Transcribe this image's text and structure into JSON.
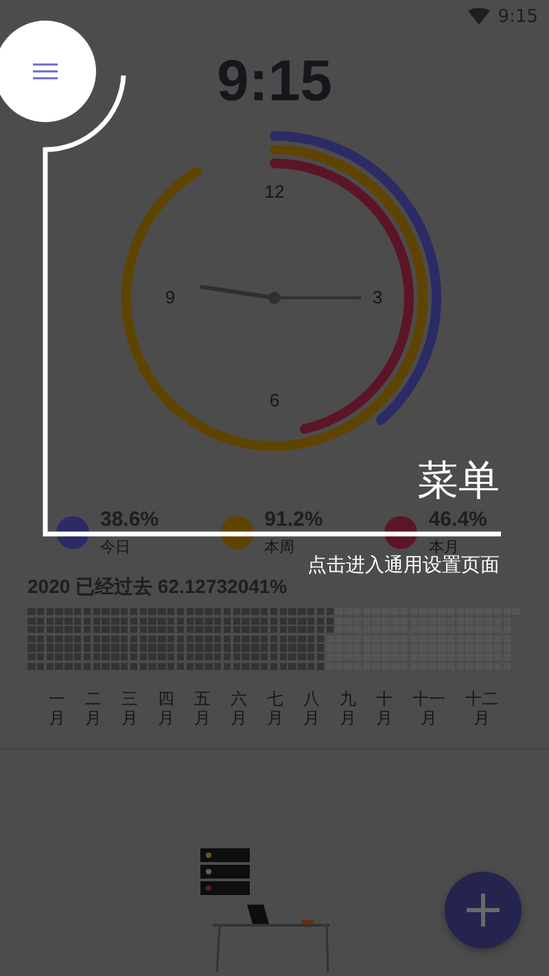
{
  "status_bar": {
    "time": "9:15"
  },
  "clock": {
    "time": "9:15",
    "dial_numbers": [
      "12",
      "3",
      "6",
      "9"
    ]
  },
  "rings": [
    {
      "value": "38.6%",
      "label": "今日",
      "color": "#2b2b66"
    },
    {
      "value": "91.2%",
      "label": "本周",
      "color": "#5f4400"
    },
    {
      "value": "46.4%",
      "label": "本月",
      "color": "#5c1526"
    }
  ],
  "year_progress": {
    "text": "2020 已经过去 62.12732041%"
  },
  "months": [
    "一月",
    "二月",
    "三月",
    "四月",
    "五月",
    "六月",
    "七月",
    "八月",
    "九月",
    "十月",
    "十一月",
    "十二月"
  ],
  "guide": {
    "title": "菜单",
    "description": "点击进入通用设置页面"
  }
}
